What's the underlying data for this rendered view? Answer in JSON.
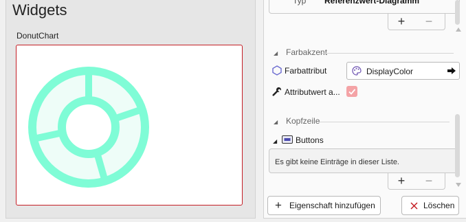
{
  "left": {
    "title": "Widgets",
    "widget_label": "DonutChart",
    "chart_color": "#7ffcd6",
    "selection_color": "#c41d24"
  },
  "chart_data": {
    "type": "pie",
    "variant": "donut-placeholder",
    "rings": 2,
    "outer_segments": [
      25,
      35,
      40
    ],
    "inner_segments": [
      20,
      30,
      50
    ],
    "color": "#7ffcd6"
  },
  "right": {
    "prev_row": {
      "label": "Typ",
      "value": "Referenzwert-Diagramm"
    },
    "add_symbol": "+",
    "remove_symbol": "−",
    "farbakzent": {
      "heading": "Farbakzent",
      "attr_label": "Farbattribut",
      "attr_value": "DisplayColor",
      "attrwert_label": "Attributwert a...",
      "checkbox_color": "#f4a3a6"
    },
    "kopfzeile": {
      "heading": "Kopfzeile",
      "buttons_label": "Buttons",
      "empty_text": "Es gibt keine Einträge in dieser Liste."
    },
    "footer": {
      "add_property": "Eigenschaft hinzufügen",
      "delete": "Löschen"
    }
  }
}
